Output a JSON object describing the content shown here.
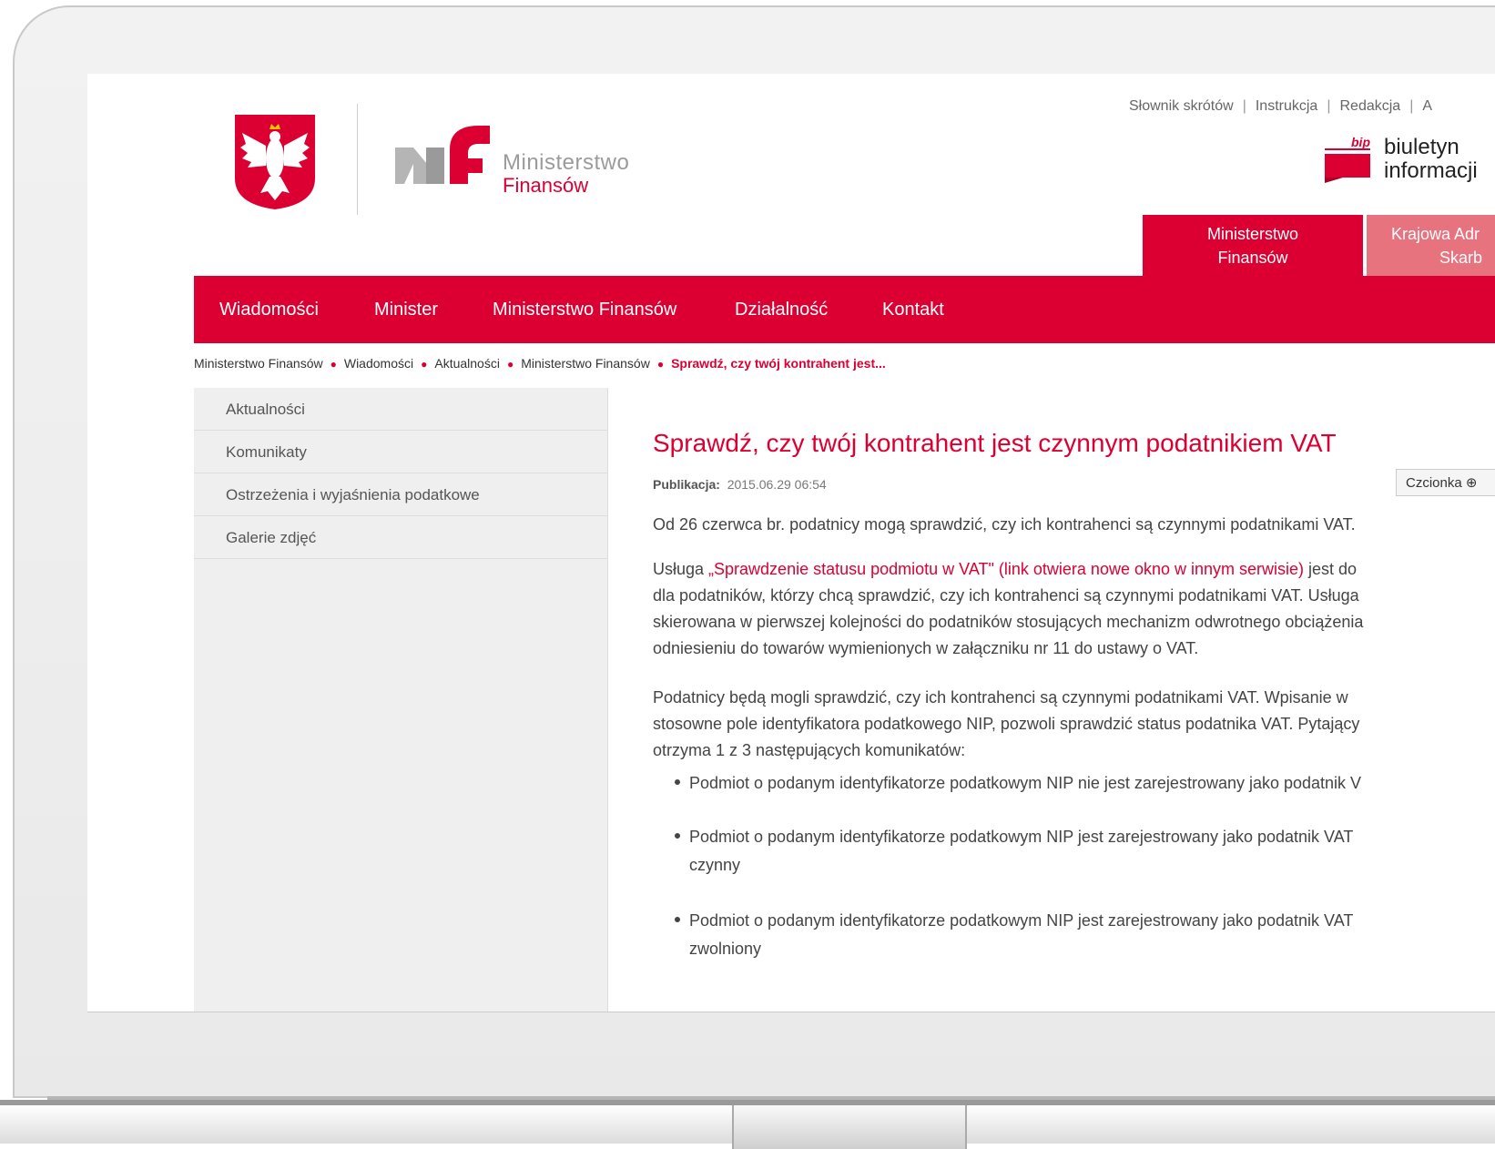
{
  "header": {
    "logo_line1": "Ministerstwo",
    "logo_line2": "Finansów",
    "top_links": [
      "Słownik skrótów",
      "Instrukcja",
      "Redakcja",
      "A"
    ],
    "bip_line1": "biuletyn",
    "bip_line2": "informacji",
    "bip_mark": "bip",
    "tab_mf_line1": "Ministerstwo",
    "tab_mf_line2": "Finansów",
    "tab_kas_line1": "Krajowa Adr",
    "tab_kas_line2": "Skarb"
  },
  "nav": {
    "items": [
      "Wiadomości",
      "Minister",
      "Ministerstwo Finansów",
      "Działalność",
      "Kontakt"
    ]
  },
  "breadcrumb": {
    "items": [
      "Ministerstwo Finansów",
      "Wiadomości",
      "Aktualności",
      "Ministerstwo Finansów"
    ],
    "current": "Sprawdź, czy twój kontrahent jest..."
  },
  "sidebar": {
    "items": [
      "Aktualności",
      "Komunikaty",
      "Ostrzeżenia i wyjaśnienia podatkowe",
      "Galerie zdjęć"
    ]
  },
  "article": {
    "title": "Sprawdź, czy twój kontrahent jest czynnym podatnikiem VAT",
    "meta_label": "Publikacja:",
    "meta_date": "2015.06.29 06:54",
    "font_button": "Czcionka ⊕",
    "lead": "Od 26 czerwca br. podatnicy mogą sprawdzić, czy ich kontrahenci są czynnymi podatnikami VAT.",
    "p1_prefix": "Usługa ",
    "p1_link": "„Sprawdzenie statusu podmiotu w VAT\" (link otwiera nowe okno w innym serwisie)",
    "p1_suffix": " jest do",
    "p1_line2": "dla podatników, którzy chcą sprawdzić, czy ich kontrahenci są czynnymi podatnikami VAT. Usługa",
    "p1_line3": "skierowana w pierwszej kolejności do podatników stosujących mechanizm odwrotnego obciążenia",
    "p1_line4": "odniesieniu do towarów wymienionych w załączniku nr 11 do ustawy o VAT.",
    "p2_line1": "Podatnicy będą mogli sprawdzić, czy ich kontrahenci są czynnymi podatnikami VAT. Wpisanie w",
    "p2_line2": "stosowne pole identyfikatora podatkowego NIP, pozwoli sprawdzić status podatnika VAT. Pytający",
    "p2_line3": "otrzyma 1 z 3 następujących komunikatów:",
    "bullet1": "Podmiot o podanym identyfikatorze podatkowym NIP nie jest zarejestrowany jako podatnik V",
    "bullet2_line1": "Podmiot o podanym identyfikatorze podatkowym NIP jest zarejestrowany jako podatnik VAT",
    "bullet2_line2": "czynny",
    "bullet3_line1": "Podmiot o podanym identyfikatorze podatkowym NIP jest zarejestrowany jako podatnik VAT",
    "bullet3_line2": "zwolniony"
  },
  "colors": {
    "accent": "#dc0032",
    "accent_light": "#e7737f",
    "sidebar_bg": "#efefef"
  }
}
